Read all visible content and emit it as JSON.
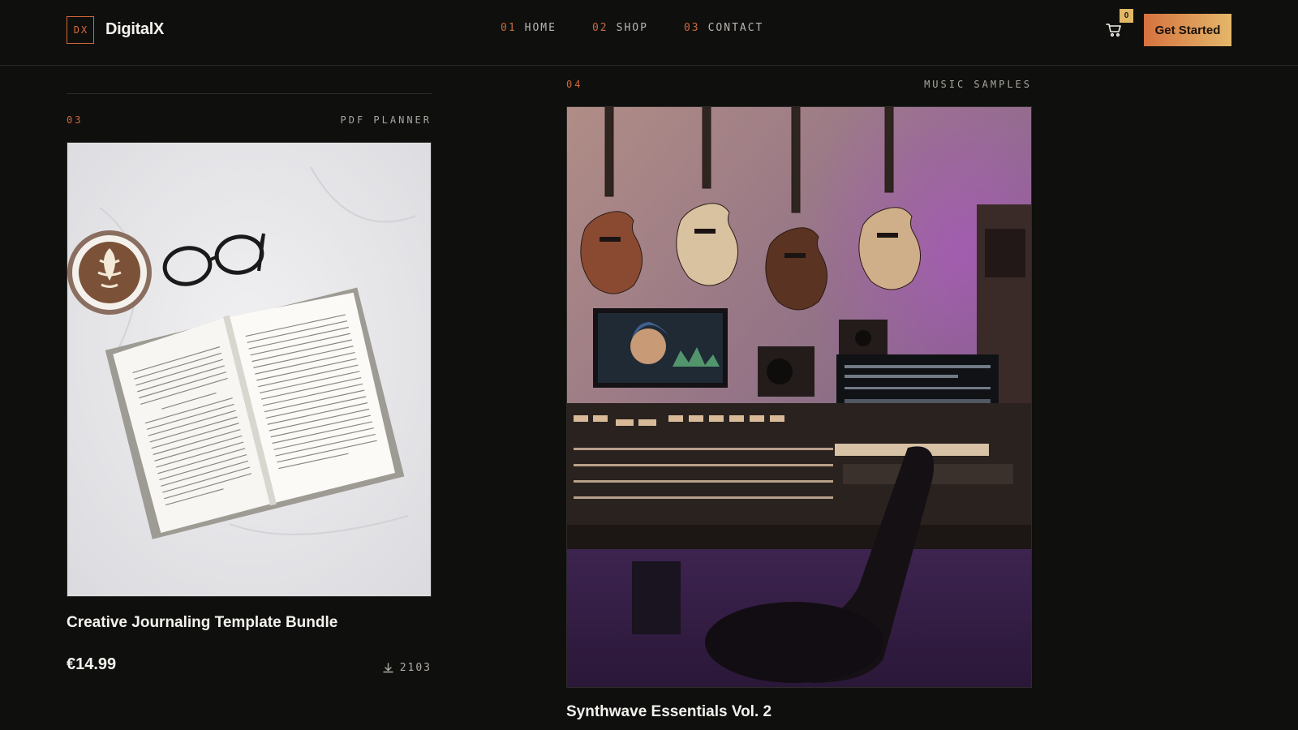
{
  "header": {
    "logo_mark": "DX",
    "brand": "DigitalX",
    "nav": [
      {
        "num": "01",
        "label": "HOME"
      },
      {
        "num": "02",
        "label": "SHOP"
      },
      {
        "num": "03",
        "label": "CONTACT"
      }
    ],
    "cart_count": "0",
    "cta_label": "Get Started"
  },
  "products": [
    {
      "num": "03",
      "category": "PDF PLANNER",
      "title": "Creative Journaling Template Bundle",
      "price": "€14.99",
      "downloads": "2103"
    },
    {
      "num": "04",
      "category": "MUSIC SAMPLES",
      "title": "Synthwave Essentials Vol. 2"
    }
  ],
  "colors": {
    "accent": "#d6723f",
    "accent_gold": "#e3b76a",
    "background": "#0f0f0e"
  }
}
